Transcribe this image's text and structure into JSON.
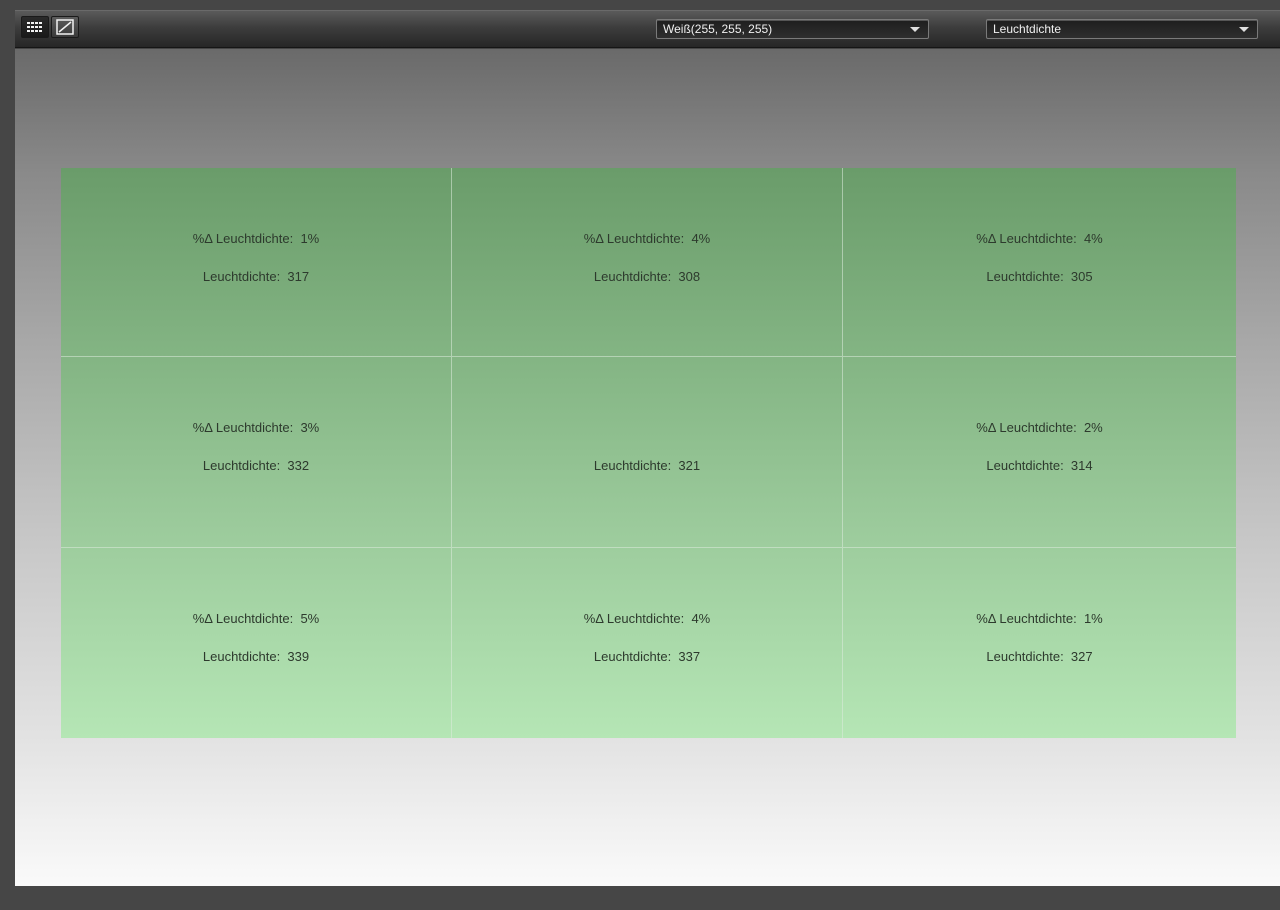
{
  "toolbar": {
    "view_buttons": [
      {
        "name": "grid-view",
        "icon": "grid-icon",
        "active": true
      },
      {
        "name": "curve-view",
        "icon": "curve-icon",
        "active": false
      }
    ],
    "color_select": {
      "value": "Weiß(255, 255, 255)"
    },
    "mode_select": {
      "value": "Leuchtdichte"
    }
  },
  "grid": {
    "cells": [
      {
        "delta": "%Δ Leuchtdichte:  1%",
        "value": "Leuchtdichte:  317"
      },
      {
        "delta": "%Δ Leuchtdichte:  4%",
        "value": "Leuchtdichte:  308"
      },
      {
        "delta": "%Δ Leuchtdichte:  4%",
        "value": "Leuchtdichte:  305"
      },
      {
        "delta": "%Δ Leuchtdichte:  3%",
        "value": "Leuchtdichte:  332"
      },
      {
        "delta": "",
        "value": "Leuchtdichte:  321"
      },
      {
        "delta": "%Δ Leuchtdichte:  2%",
        "value": "Leuchtdichte:  314"
      },
      {
        "delta": "%Δ Leuchtdichte:  5%",
        "value": "Leuchtdichte:  339"
      },
      {
        "delta": "%Δ Leuchtdichte:  4%",
        "value": "Leuchtdichte:  337"
      },
      {
        "delta": "%Δ Leuchtdichte:  1%",
        "value": "Leuchtdichte:  327"
      }
    ]
  },
  "colors": {
    "grid_top": "#6a9c6a",
    "grid_bottom": "#b5e6b5",
    "toolbar": "#3d3d3d",
    "frame": "#464646"
  }
}
